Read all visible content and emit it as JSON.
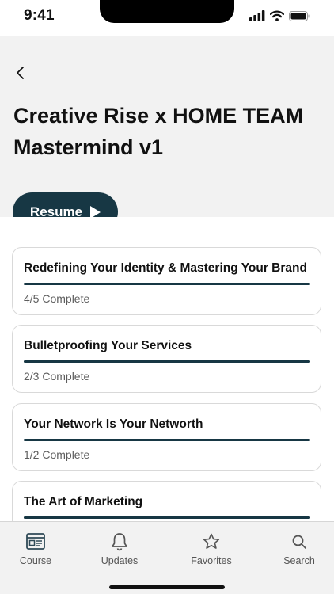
{
  "status_bar": {
    "time": "9:41"
  },
  "header": {
    "title": "Creative Rise x HOME TEAM Mastermind v1",
    "resume_label": "Resume",
    "background": "#f2f2f2",
    "accent": "#173744"
  },
  "modules": [
    {
      "title": "Redefining Your Identity & Mastering Your Brand",
      "progress_text": "4/5 Complete",
      "progress": 1.0
    },
    {
      "title": "Bulletproofing Your Services",
      "progress_text": "2/3 Complete",
      "progress": 1.0
    },
    {
      "title": "Your Network Is Your Networth",
      "progress_text": "1/2 Complete",
      "progress": 1.0
    },
    {
      "title": "The Art of Marketing",
      "progress_text": "",
      "progress": 1.0
    }
  ],
  "tabs": [
    {
      "label": "Course",
      "icon": "course-icon",
      "active": true
    },
    {
      "label": "Updates",
      "icon": "bell-icon",
      "active": false
    },
    {
      "label": "Favorites",
      "icon": "star-icon",
      "active": false
    },
    {
      "label": "Search",
      "icon": "search-icon",
      "active": false
    }
  ]
}
